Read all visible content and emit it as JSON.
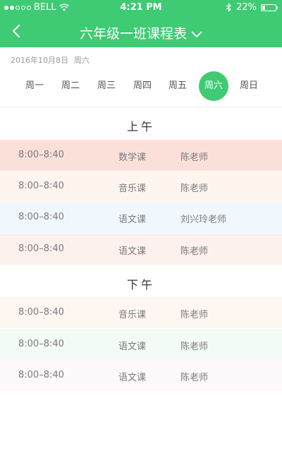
{
  "status": {
    "carrier": "BELL",
    "time": "4:21 PM",
    "battery": "22%"
  },
  "nav": {
    "title": "六年级一班课程表"
  },
  "date": {
    "text": "2016年10月8日",
    "weekday": "周六"
  },
  "week_tabs": [
    {
      "label": "周一"
    },
    {
      "label": "周二"
    },
    {
      "label": "周三"
    },
    {
      "label": "周四"
    },
    {
      "label": "周五"
    },
    {
      "label": "周六",
      "active": true
    },
    {
      "label": "周日"
    }
  ],
  "schedule": {
    "morning_label": "上午",
    "afternoon_label": "下午",
    "morning": [
      {
        "time": "8:00–8:40",
        "course": "数学课",
        "teacher": "陈老师",
        "color": "#fbe0da"
      },
      {
        "time": "8:00–8:40",
        "course": "音乐课",
        "teacher": "陈老师",
        "color": "#fef5ee"
      },
      {
        "time": "8:00–8:40",
        "course": "语文课",
        "teacher": "刘兴玲老师",
        "color": "#f1f8fd"
      },
      {
        "time": "8:00–8:40",
        "course": "语文课",
        "teacher": "陈老师",
        "color": "#fcf1ed"
      }
    ],
    "afternoon": [
      {
        "time": "8:00–8:40",
        "course": "音乐课",
        "teacher": "陈老师",
        "color": "#fef7f1"
      },
      {
        "time": "8:00–8:40",
        "course": "语文课",
        "teacher": "陈老师",
        "color": "#f3fbf6"
      },
      {
        "time": "8:00–8:40",
        "course": "语文课",
        "teacher": "陈老师",
        "color": "#fefafc"
      }
    ]
  },
  "colors": {
    "accent": "#3ecb73"
  }
}
